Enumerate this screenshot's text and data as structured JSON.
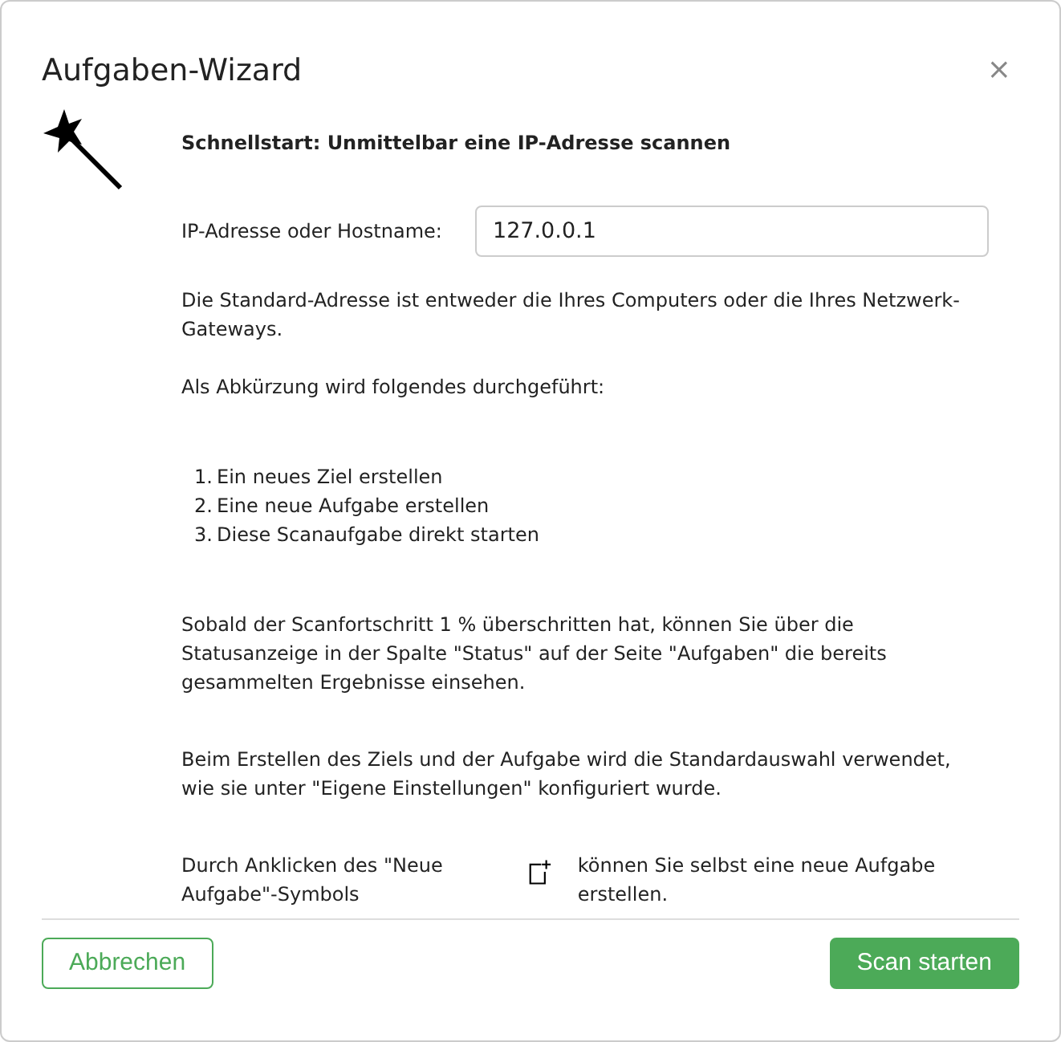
{
  "dialog": {
    "title": "Aufgaben-Wizard",
    "close": "×"
  },
  "heading": "Schnellstart: Unmittelbar eine IP-Adresse scannen",
  "ip_field": {
    "label": "IP-Adresse oder Hostname:",
    "value": "127.0.0.1"
  },
  "note": "Die Standard-Adresse ist entweder die Ihres Computers oder die Ihres Netzwerk-Gateways.",
  "steps_intro": "Als Abkürzung wird folgendes durchgeführt:",
  "steps": [
    {
      "number": "1.",
      "text": "Ein neues Ziel erstellen"
    },
    {
      "number": "2.",
      "text": "Eine neue Aufgabe erstellen"
    },
    {
      "number": "3.",
      "text": "Diese Scanaufgabe direkt starten"
    }
  ],
  "paragraphs": [
    "Sobald der Scanfortschritt 1 % überschritten hat, können Sie über die Statusanzeige in der Spalte \"Status\" auf der Seite \"Aufgaben\" die bereits gesammelten Ergebnisse einsehen.",
    "Beim Erstellen des Ziels und der Aufgabe wird die Standardauswahl verwendet, wie sie unter \"Eigene Einstellungen\" konfiguriert wurde."
  ],
  "new_task_hint": {
    "before": "Durch Anklicken des \"Neue Aufgabe\"-Symbols",
    "after": "können Sie selbst eine neue Aufgabe erstellen."
  },
  "buttons": [
    {
      "label": "Abbrechen",
      "kind": "secondary"
    },
    {
      "label": "Scan starten",
      "kind": "primary"
    }
  ]
}
